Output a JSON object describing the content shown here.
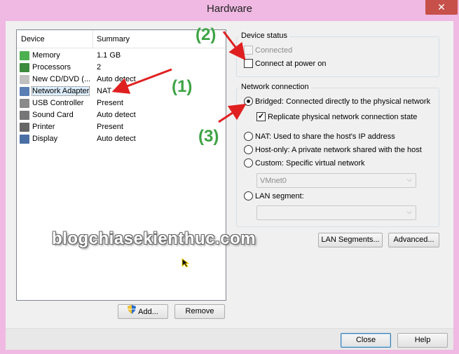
{
  "window": {
    "title": "Hardware",
    "close_glyph": "✕"
  },
  "device_list": {
    "headers": {
      "device": "Device",
      "summary": "Summary"
    },
    "rows": [
      {
        "name": "Memory",
        "summary": "1.1 GB",
        "icon": "memory-icon",
        "color": "#4caf50"
      },
      {
        "name": "Processors",
        "summary": "2",
        "icon": "processor-icon",
        "color": "#3d8b3d"
      },
      {
        "name": "New CD/DVD (...",
        "summary": "Auto detect",
        "icon": "cd-dvd-icon",
        "color": "#c0c0c0"
      },
      {
        "name": "Network Adapter",
        "summary": "NAT",
        "icon": "network-adapter-icon",
        "color": "#5a7fb5"
      },
      {
        "name": "USB Controller",
        "summary": "Present",
        "icon": "usb-icon",
        "color": "#8a8a8a"
      },
      {
        "name": "Sound Card",
        "summary": "Auto detect",
        "icon": "speaker-icon",
        "color": "#777777"
      },
      {
        "name": "Printer",
        "summary": "Present",
        "icon": "printer-icon",
        "color": "#666666"
      },
      {
        "name": "Display",
        "summary": "Auto detect",
        "icon": "monitor-icon",
        "color": "#4a6fa5"
      }
    ],
    "selected_index": 3
  },
  "buttons": {
    "add": "Add...",
    "remove": "Remove",
    "lan_segments": "LAN Segments...",
    "advanced": "Advanced...",
    "close": "Close",
    "help": "Help"
  },
  "device_status": {
    "label": "Device status",
    "connected": {
      "label": "Connected",
      "checked": false,
      "disabled": true
    },
    "connect_at_power_on": {
      "label": "Connect at power on",
      "checked": false
    }
  },
  "network_connection": {
    "label": "Network connection",
    "options": {
      "bridged": "Bridged: Connected directly to the physical network",
      "replicate": "Replicate physical network connection state",
      "nat": "NAT: Used to share the host's IP address",
      "host_only": "Host-only: A private network shared with the host",
      "custom": "Custom: Specific virtual network",
      "lan_segment": "LAN segment:"
    },
    "selected": "bridged",
    "replicate_checked": true,
    "custom_network_value": "VMnet0",
    "lan_segment_value": ""
  },
  "annotations": {
    "one": "(1)",
    "two": "(2)",
    "three": "(3)",
    "color": "#3ea345",
    "arrow_color": "#e02020"
  },
  "watermark": "blogchiasekienthuc.com",
  "cursor_glyph": "↖"
}
